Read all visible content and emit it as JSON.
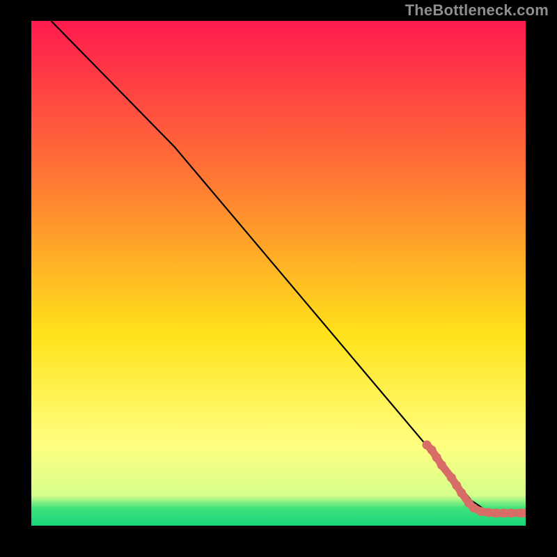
{
  "attribution": "TheBottleneck.com",
  "colors": {
    "background": "#000000",
    "attribution_text": "#8e8e8e",
    "line": "#000000",
    "marker": "#d86c67",
    "grad_top": "#ff1a4e",
    "grad_upper_mid": "#ff7a33",
    "grad_mid": "#ffe21a",
    "grad_lower_band_top": "#ffff80",
    "grad_lower_band_bottom": "#d6ff8c",
    "grad_green_top": "#3fe27a",
    "grad_green_bottom": "#17d67a"
  },
  "chart_data": {
    "type": "line",
    "title": "",
    "xlabel": "",
    "ylabel": "",
    "xlim": [
      0,
      100
    ],
    "ylim": [
      0,
      100
    ],
    "grid": false,
    "legend": false,
    "series": [
      {
        "name": "curve",
        "style": "solid-black",
        "points": [
          {
            "x": 4,
            "y": 100
          },
          {
            "x": 29,
            "y": 75
          },
          {
            "x": 82,
            "y": 13.5
          },
          {
            "x": 89,
            "y": 5
          },
          {
            "x": 92,
            "y": 3
          },
          {
            "x": 100,
            "y": 2.5
          }
        ]
      },
      {
        "name": "markers",
        "style": "red-dots-thick",
        "points": [
          {
            "x": 80,
            "y": 16
          },
          {
            "x": 81,
            "y": 15
          },
          {
            "x": 82,
            "y": 13.5
          },
          {
            "x": 83,
            "y": 12
          },
          {
            "x": 85,
            "y": 9.5
          },
          {
            "x": 86,
            "y": 8
          },
          {
            "x": 87,
            "y": 6.5
          },
          {
            "x": 88.5,
            "y": 4.5
          },
          {
            "x": 89.5,
            "y": 3.5
          },
          {
            "x": 91,
            "y": 2.8
          },
          {
            "x": 92.5,
            "y": 2.6
          },
          {
            "x": 94,
            "y": 2.5
          },
          {
            "x": 95.5,
            "y": 2.5
          },
          {
            "x": 97,
            "y": 2.5
          },
          {
            "x": 99,
            "y": 2.5
          },
          {
            "x": 100,
            "y": 2.5
          }
        ]
      }
    ]
  }
}
